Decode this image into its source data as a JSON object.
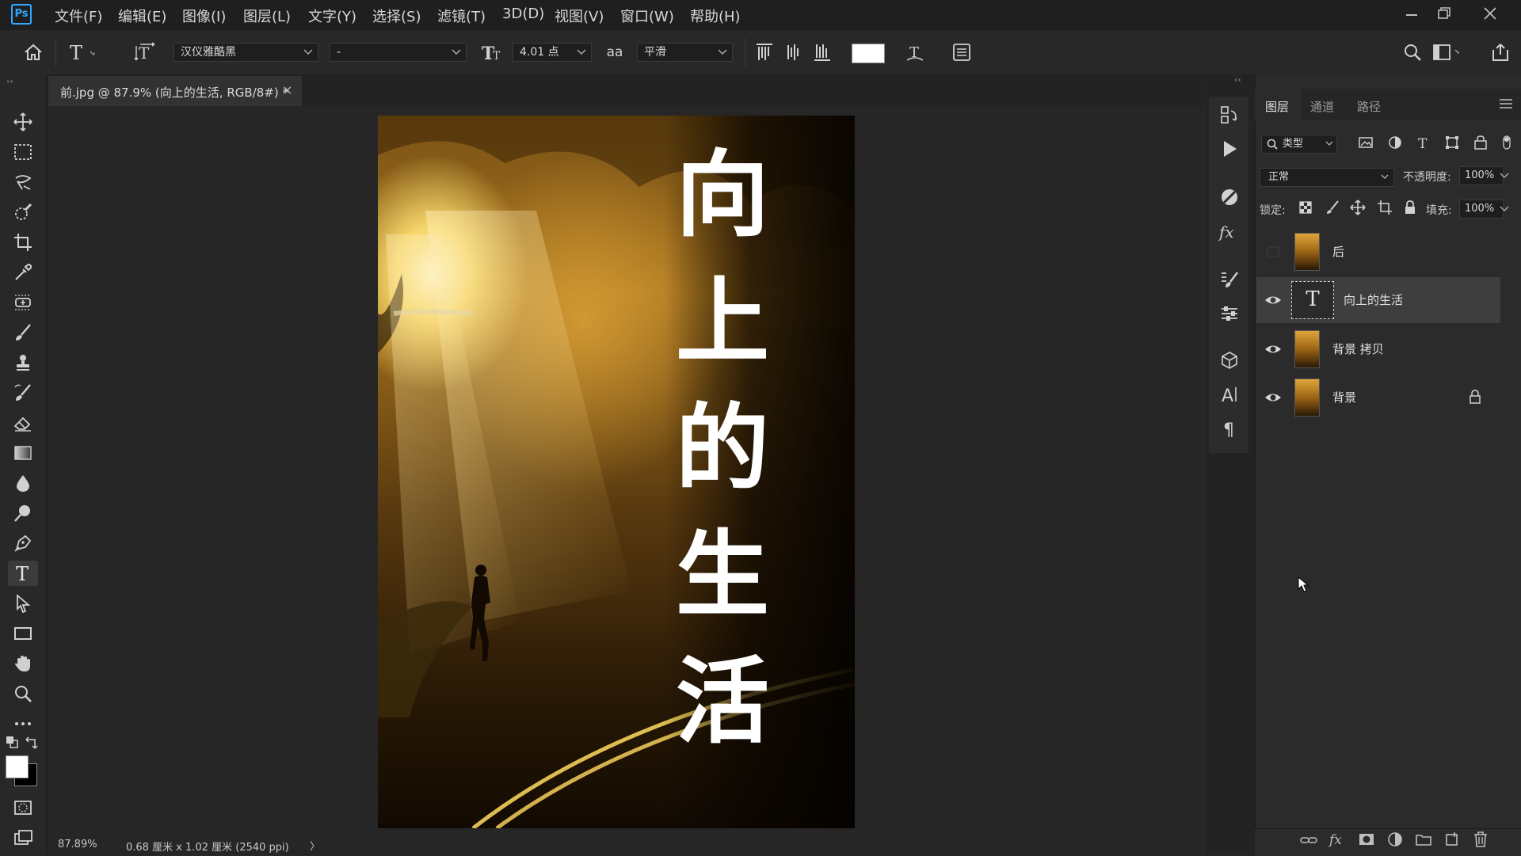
{
  "app": {
    "logo": "Ps"
  },
  "menubar": {
    "items": [
      "文件(F)",
      "编辑(E)",
      "图像(I)",
      "图层(L)",
      "文字(Y)",
      "选择(S)",
      "滤镜(T)",
      "3D(D)",
      "视图(V)",
      "窗口(W)",
      "帮助(H)"
    ]
  },
  "options": {
    "font_family": "汉仪雅酷黑",
    "font_style": "-",
    "font_size": "4.01 点",
    "aa_icon_label": "aa",
    "antialias": "平滑",
    "text_color": "#ffffff"
  },
  "document": {
    "tab_title": "前.jpg @ 87.9% (向上的生活, RGB/8#) *",
    "close": "×",
    "canvas_text": [
      "向",
      "上",
      "的",
      "生",
      "活"
    ]
  },
  "status": {
    "zoom": "87.89%",
    "info": "0.68 厘米 x 1.02 厘米 (2540 ppi)",
    "arrow": "〉"
  },
  "layers_panel": {
    "tabs": [
      "图层",
      "通道",
      "路径"
    ],
    "filter_kind": "类型",
    "blend_mode": "正常",
    "opacity_label": "不透明度:",
    "opacity_value": "100%",
    "lock_label": "锁定:",
    "fill_label": "填充:",
    "fill_value": "100%",
    "layers": [
      {
        "name": "后",
        "visible": false,
        "type": "image",
        "selected": false,
        "locked": false
      },
      {
        "name": "向上的生活",
        "visible": true,
        "type": "text",
        "selected": true,
        "locked": false,
        "thumb_glyph": "T"
      },
      {
        "name": "背景 拷贝",
        "visible": true,
        "type": "image",
        "selected": false,
        "locked": false
      },
      {
        "name": "背景",
        "visible": true,
        "type": "image",
        "selected": false,
        "locked": true
      }
    ]
  },
  "colors": {
    "accent": "#31a8ff",
    "foreground": "#ffffff",
    "background": "#000000"
  }
}
